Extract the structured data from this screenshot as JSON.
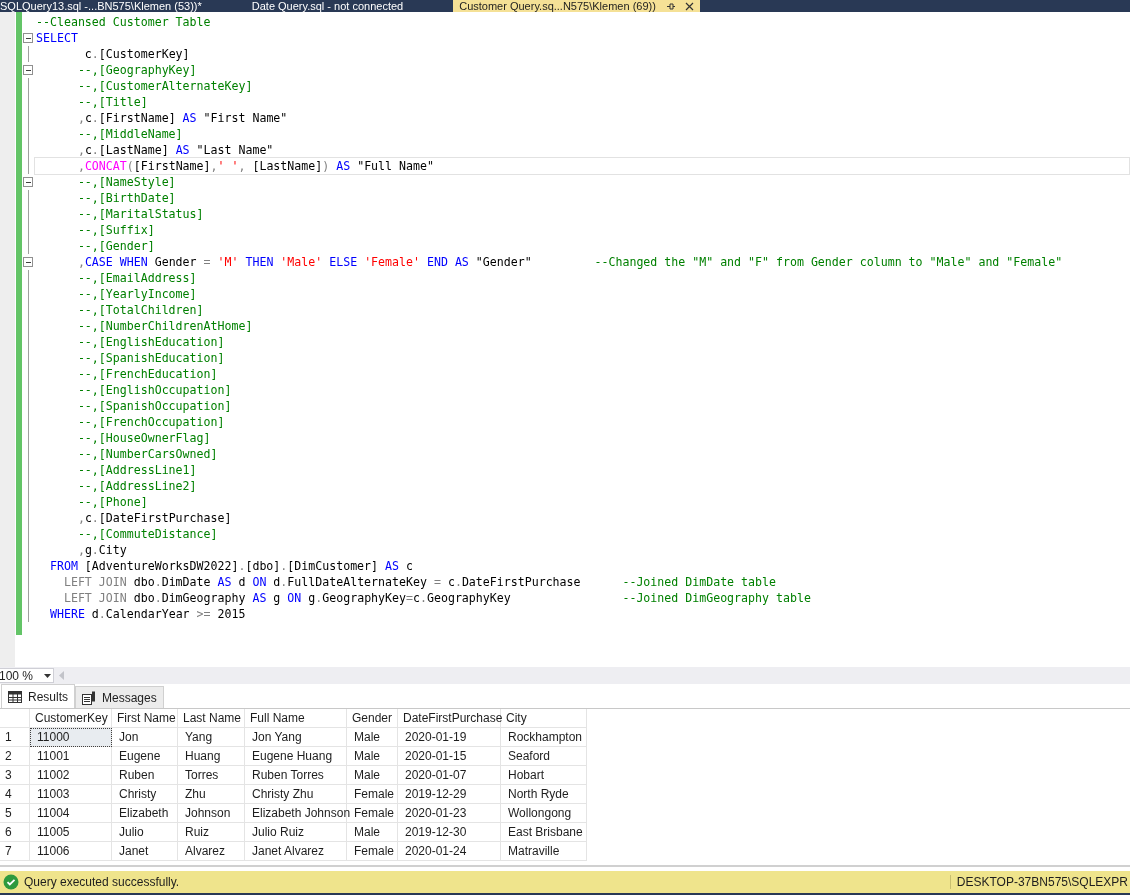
{
  "tabs": [
    {
      "label": "SQLQuery13.sql -...BN575\\Klemen (53))*",
      "selected": false
    },
    {
      "label": "Date Query.sql - not connected",
      "selected": false
    },
    {
      "label": "Customer Query.sq...N575\\Klemen (69))",
      "selected": true
    }
  ],
  "editor": {
    "lines": [
      {
        "fold": false,
        "current": false,
        "tokens": [
          {
            "kind": "comment",
            "text": "--Cleansed Customer Table"
          }
        ]
      },
      {
        "fold": true,
        "current": false,
        "tokens": [
          {
            "kind": "keyword",
            "text": "SELECT"
          }
        ]
      },
      {
        "fold": false,
        "current": false,
        "tokens": [
          {
            "kind": "plain",
            "text": "       c"
          },
          {
            "kind": "op",
            "text": "."
          },
          {
            "kind": "plain",
            "text": "[CustomerKey]"
          }
        ]
      },
      {
        "fold": true,
        "current": false,
        "tokens": [
          {
            "kind": "comment",
            "text": "      --,[GeographyKey]"
          }
        ]
      },
      {
        "fold": false,
        "current": false,
        "tokens": [
          {
            "kind": "comment",
            "text": "      --,[CustomerAlternateKey]"
          }
        ]
      },
      {
        "fold": false,
        "current": false,
        "tokens": [
          {
            "kind": "comment",
            "text": "      --,[Title]"
          }
        ]
      },
      {
        "fold": false,
        "current": false,
        "tokens": [
          {
            "kind": "op",
            "text": "      ,"
          },
          {
            "kind": "plain",
            "text": "c"
          },
          {
            "kind": "op",
            "text": "."
          },
          {
            "kind": "plain",
            "text": "[FirstName] "
          },
          {
            "kind": "keyword",
            "text": "AS"
          },
          {
            "kind": "plain",
            "text": " \"First Name\""
          }
        ]
      },
      {
        "fold": false,
        "current": false,
        "tokens": [
          {
            "kind": "comment",
            "text": "      --,[MiddleName]"
          }
        ]
      },
      {
        "fold": false,
        "current": false,
        "tokens": [
          {
            "kind": "op",
            "text": "      ,"
          },
          {
            "kind": "plain",
            "text": "c"
          },
          {
            "kind": "op",
            "text": "."
          },
          {
            "kind": "plain",
            "text": "[LastName] "
          },
          {
            "kind": "keyword",
            "text": "AS"
          },
          {
            "kind": "plain",
            "text": " \"Last Name\""
          }
        ]
      },
      {
        "fold": false,
        "current": true,
        "tokens": [
          {
            "kind": "op",
            "text": "      ,"
          },
          {
            "kind": "function",
            "text": "CONCAT"
          },
          {
            "kind": "op",
            "text": "("
          },
          {
            "kind": "plain",
            "text": "[FirstName]"
          },
          {
            "kind": "op",
            "text": ","
          },
          {
            "kind": "string",
            "text": "' '"
          },
          {
            "kind": "op",
            "text": ","
          },
          {
            "kind": "plain",
            "text": " [LastName]"
          },
          {
            "kind": "op",
            "text": ") "
          },
          {
            "kind": "keyword",
            "text": "AS"
          },
          {
            "kind": "plain",
            "text": " \"Full Name\""
          }
        ]
      },
      {
        "fold": true,
        "current": false,
        "tokens": [
          {
            "kind": "comment",
            "text": "      --,[NameStyle]"
          }
        ]
      },
      {
        "fold": false,
        "current": false,
        "tokens": [
          {
            "kind": "comment",
            "text": "      --,[BirthDate]"
          }
        ]
      },
      {
        "fold": false,
        "current": false,
        "tokens": [
          {
            "kind": "comment",
            "text": "      --,[MaritalStatus]"
          }
        ]
      },
      {
        "fold": false,
        "current": false,
        "tokens": [
          {
            "kind": "comment",
            "text": "      --,[Suffix]"
          }
        ]
      },
      {
        "fold": false,
        "current": false,
        "tokens": [
          {
            "kind": "comment",
            "text": "      --,[Gender]"
          }
        ]
      },
      {
        "fold": true,
        "current": false,
        "tokens": [
          {
            "kind": "op",
            "text": "      ,"
          },
          {
            "kind": "keyword",
            "text": "CASE WHEN"
          },
          {
            "kind": "plain",
            "text": " Gender "
          },
          {
            "kind": "op",
            "text": "= "
          },
          {
            "kind": "string",
            "text": "'M'"
          },
          {
            "kind": "keyword",
            "text": " THEN "
          },
          {
            "kind": "string",
            "text": "'Male'"
          },
          {
            "kind": "keyword",
            "text": " ELSE "
          },
          {
            "kind": "string",
            "text": "'Female'"
          },
          {
            "kind": "keyword",
            "text": " END AS"
          },
          {
            "kind": "plain",
            "text": " \"Gender\"         "
          },
          {
            "kind": "comment",
            "text": "--Changed the \"M\" and \"F\" from Gender column to \"Male\" and \"Female\""
          }
        ]
      },
      {
        "fold": false,
        "current": false,
        "tokens": [
          {
            "kind": "comment",
            "text": "      --,[EmailAddress]"
          }
        ]
      },
      {
        "fold": false,
        "current": false,
        "tokens": [
          {
            "kind": "comment",
            "text": "      --,[YearlyIncome]"
          }
        ]
      },
      {
        "fold": false,
        "current": false,
        "tokens": [
          {
            "kind": "comment",
            "text": "      --,[TotalChildren]"
          }
        ]
      },
      {
        "fold": false,
        "current": false,
        "tokens": [
          {
            "kind": "comment",
            "text": "      --,[NumberChildrenAtHome]"
          }
        ]
      },
      {
        "fold": false,
        "current": false,
        "tokens": [
          {
            "kind": "comment",
            "text": "      --,[EnglishEducation]"
          }
        ]
      },
      {
        "fold": false,
        "current": false,
        "tokens": [
          {
            "kind": "comment",
            "text": "      --,[SpanishEducation]"
          }
        ]
      },
      {
        "fold": false,
        "current": false,
        "tokens": [
          {
            "kind": "comment",
            "text": "      --,[FrenchEducation]"
          }
        ]
      },
      {
        "fold": false,
        "current": false,
        "tokens": [
          {
            "kind": "comment",
            "text": "      --,[EnglishOccupation]"
          }
        ]
      },
      {
        "fold": false,
        "current": false,
        "tokens": [
          {
            "kind": "comment",
            "text": "      --,[SpanishOccupation]"
          }
        ]
      },
      {
        "fold": false,
        "current": false,
        "tokens": [
          {
            "kind": "comment",
            "text": "      --,[FrenchOccupation]"
          }
        ]
      },
      {
        "fold": false,
        "current": false,
        "tokens": [
          {
            "kind": "comment",
            "text": "      --,[HouseOwnerFlag]"
          }
        ]
      },
      {
        "fold": false,
        "current": false,
        "tokens": [
          {
            "kind": "comment",
            "text": "      --,[NumberCarsOwned]"
          }
        ]
      },
      {
        "fold": false,
        "current": false,
        "tokens": [
          {
            "kind": "comment",
            "text": "      --,[AddressLine1]"
          }
        ]
      },
      {
        "fold": false,
        "current": false,
        "tokens": [
          {
            "kind": "comment",
            "text": "      --,[AddressLine2]"
          }
        ]
      },
      {
        "fold": false,
        "current": false,
        "tokens": [
          {
            "kind": "comment",
            "text": "      --,[Phone]"
          }
        ]
      },
      {
        "fold": false,
        "current": false,
        "tokens": [
          {
            "kind": "op",
            "text": "      ,"
          },
          {
            "kind": "plain",
            "text": "c"
          },
          {
            "kind": "op",
            "text": "."
          },
          {
            "kind": "plain",
            "text": "[DateFirstPurchase]"
          }
        ]
      },
      {
        "fold": false,
        "current": false,
        "tokens": [
          {
            "kind": "comment",
            "text": "      --,[CommuteDistance]"
          }
        ]
      },
      {
        "fold": false,
        "current": false,
        "tokens": [
          {
            "kind": "op",
            "text": "      ,"
          },
          {
            "kind": "plain",
            "text": "g"
          },
          {
            "kind": "op",
            "text": "."
          },
          {
            "kind": "plain",
            "text": "City"
          }
        ]
      },
      {
        "fold": false,
        "current": false,
        "tokens": [
          {
            "kind": "keyword",
            "text": "  FROM"
          },
          {
            "kind": "plain",
            "text": " [AdventureWorksDW2022]"
          },
          {
            "kind": "op",
            "text": "."
          },
          {
            "kind": "plain",
            "text": "[dbo]"
          },
          {
            "kind": "op",
            "text": "."
          },
          {
            "kind": "plain",
            "text": "[DimCustomer] "
          },
          {
            "kind": "keyword",
            "text": "AS"
          },
          {
            "kind": "plain",
            "text": " c"
          }
        ]
      },
      {
        "fold": false,
        "current": false,
        "tokens": [
          {
            "kind": "op",
            "text": "    LEFT JOIN"
          },
          {
            "kind": "plain",
            "text": " dbo"
          },
          {
            "kind": "op",
            "text": "."
          },
          {
            "kind": "plain",
            "text": "DimDate "
          },
          {
            "kind": "keyword",
            "text": "AS"
          },
          {
            "kind": "plain",
            "text": " d "
          },
          {
            "kind": "keyword",
            "text": "ON"
          },
          {
            "kind": "plain",
            "text": " d"
          },
          {
            "kind": "op",
            "text": "."
          },
          {
            "kind": "plain",
            "text": "FullDateAlternateKey "
          },
          {
            "kind": "op",
            "text": "="
          },
          {
            "kind": "plain",
            "text": " c"
          },
          {
            "kind": "op",
            "text": "."
          },
          {
            "kind": "plain",
            "text": "DateFirstPurchase      "
          },
          {
            "kind": "comment",
            "text": "--Joined DimDate table"
          }
        ]
      },
      {
        "fold": false,
        "current": false,
        "tokens": [
          {
            "kind": "op",
            "text": "    LEFT JOIN"
          },
          {
            "kind": "plain",
            "text": " dbo"
          },
          {
            "kind": "op",
            "text": "."
          },
          {
            "kind": "plain",
            "text": "DimGeography "
          },
          {
            "kind": "keyword",
            "text": "AS"
          },
          {
            "kind": "plain",
            "text": " g "
          },
          {
            "kind": "keyword",
            "text": "ON"
          },
          {
            "kind": "plain",
            "text": " g"
          },
          {
            "kind": "op",
            "text": "."
          },
          {
            "kind": "plain",
            "text": "GeographyKey"
          },
          {
            "kind": "op",
            "text": "="
          },
          {
            "kind": "plain",
            "text": "c"
          },
          {
            "kind": "op",
            "text": "."
          },
          {
            "kind": "plain",
            "text": "GeographyKey                "
          },
          {
            "kind": "comment",
            "text": "--Joined DimGeography table"
          }
        ]
      },
      {
        "fold": false,
        "current": false,
        "tokens": [
          {
            "kind": "keyword",
            "text": "  WHERE"
          },
          {
            "kind": "plain",
            "text": " d"
          },
          {
            "kind": "op",
            "text": "."
          },
          {
            "kind": "plain",
            "text": "CalendarYear "
          },
          {
            "kind": "op",
            "text": ">="
          },
          {
            "kind": "plain",
            "text": " 2015"
          }
        ]
      }
    ]
  },
  "zoom": {
    "value": "100 %"
  },
  "result_tabs": [
    {
      "label": "Results",
      "selected": true
    },
    {
      "label": "Messages",
      "selected": false
    }
  ],
  "table": {
    "columns": [
      "CustomerKey",
      "First Name",
      "Last Name",
      "Full Name",
      "Gender",
      "DateFirstPurchase",
      "City"
    ],
    "rows": [
      {
        "number": "1",
        "focused": true,
        "cells": [
          "11000",
          "Jon",
          "Yang",
          "Jon Yang",
          "Male",
          "2020-01-19",
          "Rockhampton"
        ]
      },
      {
        "number": "2",
        "focused": false,
        "cells": [
          "11001",
          "Eugene",
          "Huang",
          "Eugene Huang",
          "Male",
          "2020-01-15",
          "Seaford"
        ]
      },
      {
        "number": "3",
        "focused": false,
        "cells": [
          "11002",
          "Ruben",
          "Torres",
          "Ruben Torres",
          "Male",
          "2020-01-07",
          "Hobart"
        ]
      },
      {
        "number": "4",
        "focused": false,
        "cells": [
          "11003",
          "Christy",
          "Zhu",
          "Christy Zhu",
          "Female",
          "2019-12-29",
          "North Ryde"
        ]
      },
      {
        "number": "5",
        "focused": false,
        "cells": [
          "11004",
          "Elizabeth",
          "Johnson",
          "Elizabeth Johnson",
          "Female",
          "2020-01-23",
          "Wollongong"
        ]
      },
      {
        "number": "6",
        "focused": false,
        "cells": [
          "11005",
          "Julio",
          "Ruiz",
          "Julio Ruiz",
          "Male",
          "2019-12-30",
          "East Brisbane"
        ]
      },
      {
        "number": "7",
        "focused": false,
        "cells": [
          "11006",
          "Janet",
          "Alvarez",
          "Janet Alvarez",
          "Female",
          "2020-01-24",
          "Matraville"
        ]
      }
    ]
  },
  "status_bar": {
    "message": "Query executed successfully.",
    "server": "DESKTOP-37BN575\\SQLEXPR"
  }
}
